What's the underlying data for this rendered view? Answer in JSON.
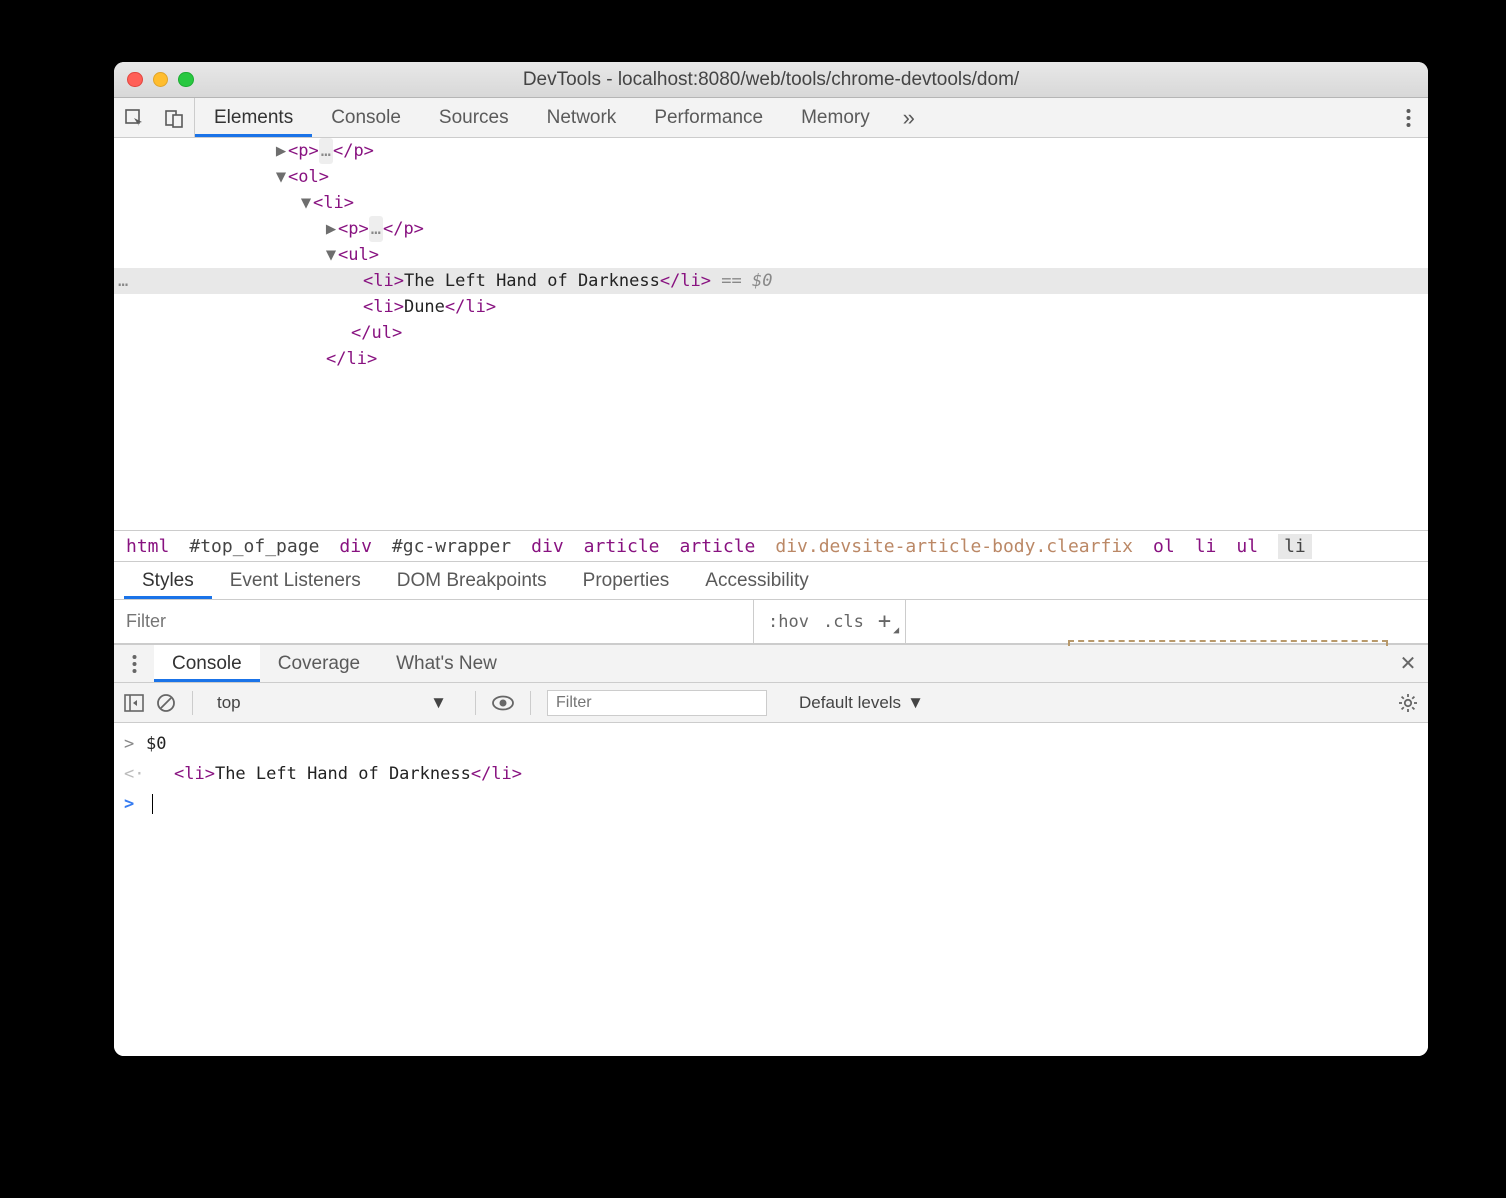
{
  "window": {
    "title": "DevTools - localhost:8080/web/tools/chrome-devtools/dom/"
  },
  "main_tabs": [
    "Elements",
    "Console",
    "Sources",
    "Network",
    "Performance",
    "Memory"
  ],
  "main_tabs_active": "Elements",
  "dom_lines": [
    {
      "indent": 260,
      "arrow": "▶",
      "parts": [
        {
          "t": "tag",
          "v": "<p>"
        },
        {
          "t": "ellip",
          "v": "…"
        },
        {
          "t": "tag",
          "v": "</p>"
        }
      ]
    },
    {
      "indent": 260,
      "arrow": "▼",
      "parts": [
        {
          "t": "tag",
          "v": "<ol>"
        }
      ]
    },
    {
      "indent": 285,
      "arrow": "▼",
      "parts": [
        {
          "t": "tag",
          "v": "<li>"
        }
      ]
    },
    {
      "indent": 310,
      "arrow": "▶",
      "parts": [
        {
          "t": "tag",
          "v": "<p>"
        },
        {
          "t": "ellip",
          "v": "…"
        },
        {
          "t": "tag",
          "v": "</p>"
        }
      ]
    },
    {
      "indent": 310,
      "arrow": "▼",
      "parts": [
        {
          "t": "tag",
          "v": "<ul>"
        }
      ]
    },
    {
      "indent": 335,
      "arrow": "",
      "highlight": true,
      "gutter": "…",
      "parts": [
        {
          "t": "tag",
          "v": "<li>"
        },
        {
          "t": "txt",
          "v": "The Left Hand of Darkness"
        },
        {
          "t": "tag",
          "v": "</li>"
        },
        {
          "t": "hint",
          "v": " == $0"
        }
      ]
    },
    {
      "indent": 335,
      "arrow": "",
      "parts": [
        {
          "t": "tag",
          "v": "<li>"
        },
        {
          "t": "txt",
          "v": "Dune"
        },
        {
          "t": "tag",
          "v": "</li>"
        }
      ]
    },
    {
      "indent": 323,
      "arrow": "",
      "parts": [
        {
          "t": "tag",
          "v": "</ul>"
        }
      ]
    },
    {
      "indent": 298,
      "arrow": "",
      "parts": [
        {
          "t": "tag",
          "v": "</li>"
        }
      ]
    }
  ],
  "breadcrumbs": [
    {
      "label": "html",
      "cls": "bc"
    },
    {
      "label": "#top_of_page",
      "cls": "bc idsel"
    },
    {
      "label": "div",
      "cls": "bc"
    },
    {
      "label": "#gc-wrapper",
      "cls": "bc idsel"
    },
    {
      "label": "div",
      "cls": "bc"
    },
    {
      "label": "article",
      "cls": "bc"
    },
    {
      "label": "article",
      "cls": "bc"
    },
    {
      "label": "div.devsite-article-body.clearfix",
      "cls": "bc dim"
    },
    {
      "label": "ol",
      "cls": "bc"
    },
    {
      "label": "li",
      "cls": "bc"
    },
    {
      "label": "ul",
      "cls": "bc"
    },
    {
      "label": "li",
      "cls": "bc sel"
    }
  ],
  "sub_tabs": [
    "Styles",
    "Event Listeners",
    "DOM Breakpoints",
    "Properties",
    "Accessibility"
  ],
  "sub_tabs_active": "Styles",
  "styles_filter_placeholder": "Filter",
  "styles_actions": {
    "hov": ":hov",
    "cls": ".cls"
  },
  "drawer_tabs": [
    "Console",
    "Coverage",
    "What's New"
  ],
  "drawer_tabs_active": "Console",
  "console_toolbar": {
    "context": "top",
    "filter_placeholder": "Filter",
    "levels": "Default levels"
  },
  "console_rows": [
    {
      "caret": ">",
      "caret_cls": "",
      "content": [
        {
          "t": "txt",
          "v": "$0"
        }
      ]
    },
    {
      "caret": "<·",
      "caret_cls": "lt",
      "indent": 28,
      "content": [
        {
          "t": "tag",
          "v": "<li>"
        },
        {
          "t": "txt",
          "v": "The Left Hand of Darkness"
        },
        {
          "t": "tag",
          "v": "</li>"
        }
      ]
    },
    {
      "caret": ">",
      "caret_cls": "blue",
      "cursor": true,
      "content": []
    }
  ]
}
